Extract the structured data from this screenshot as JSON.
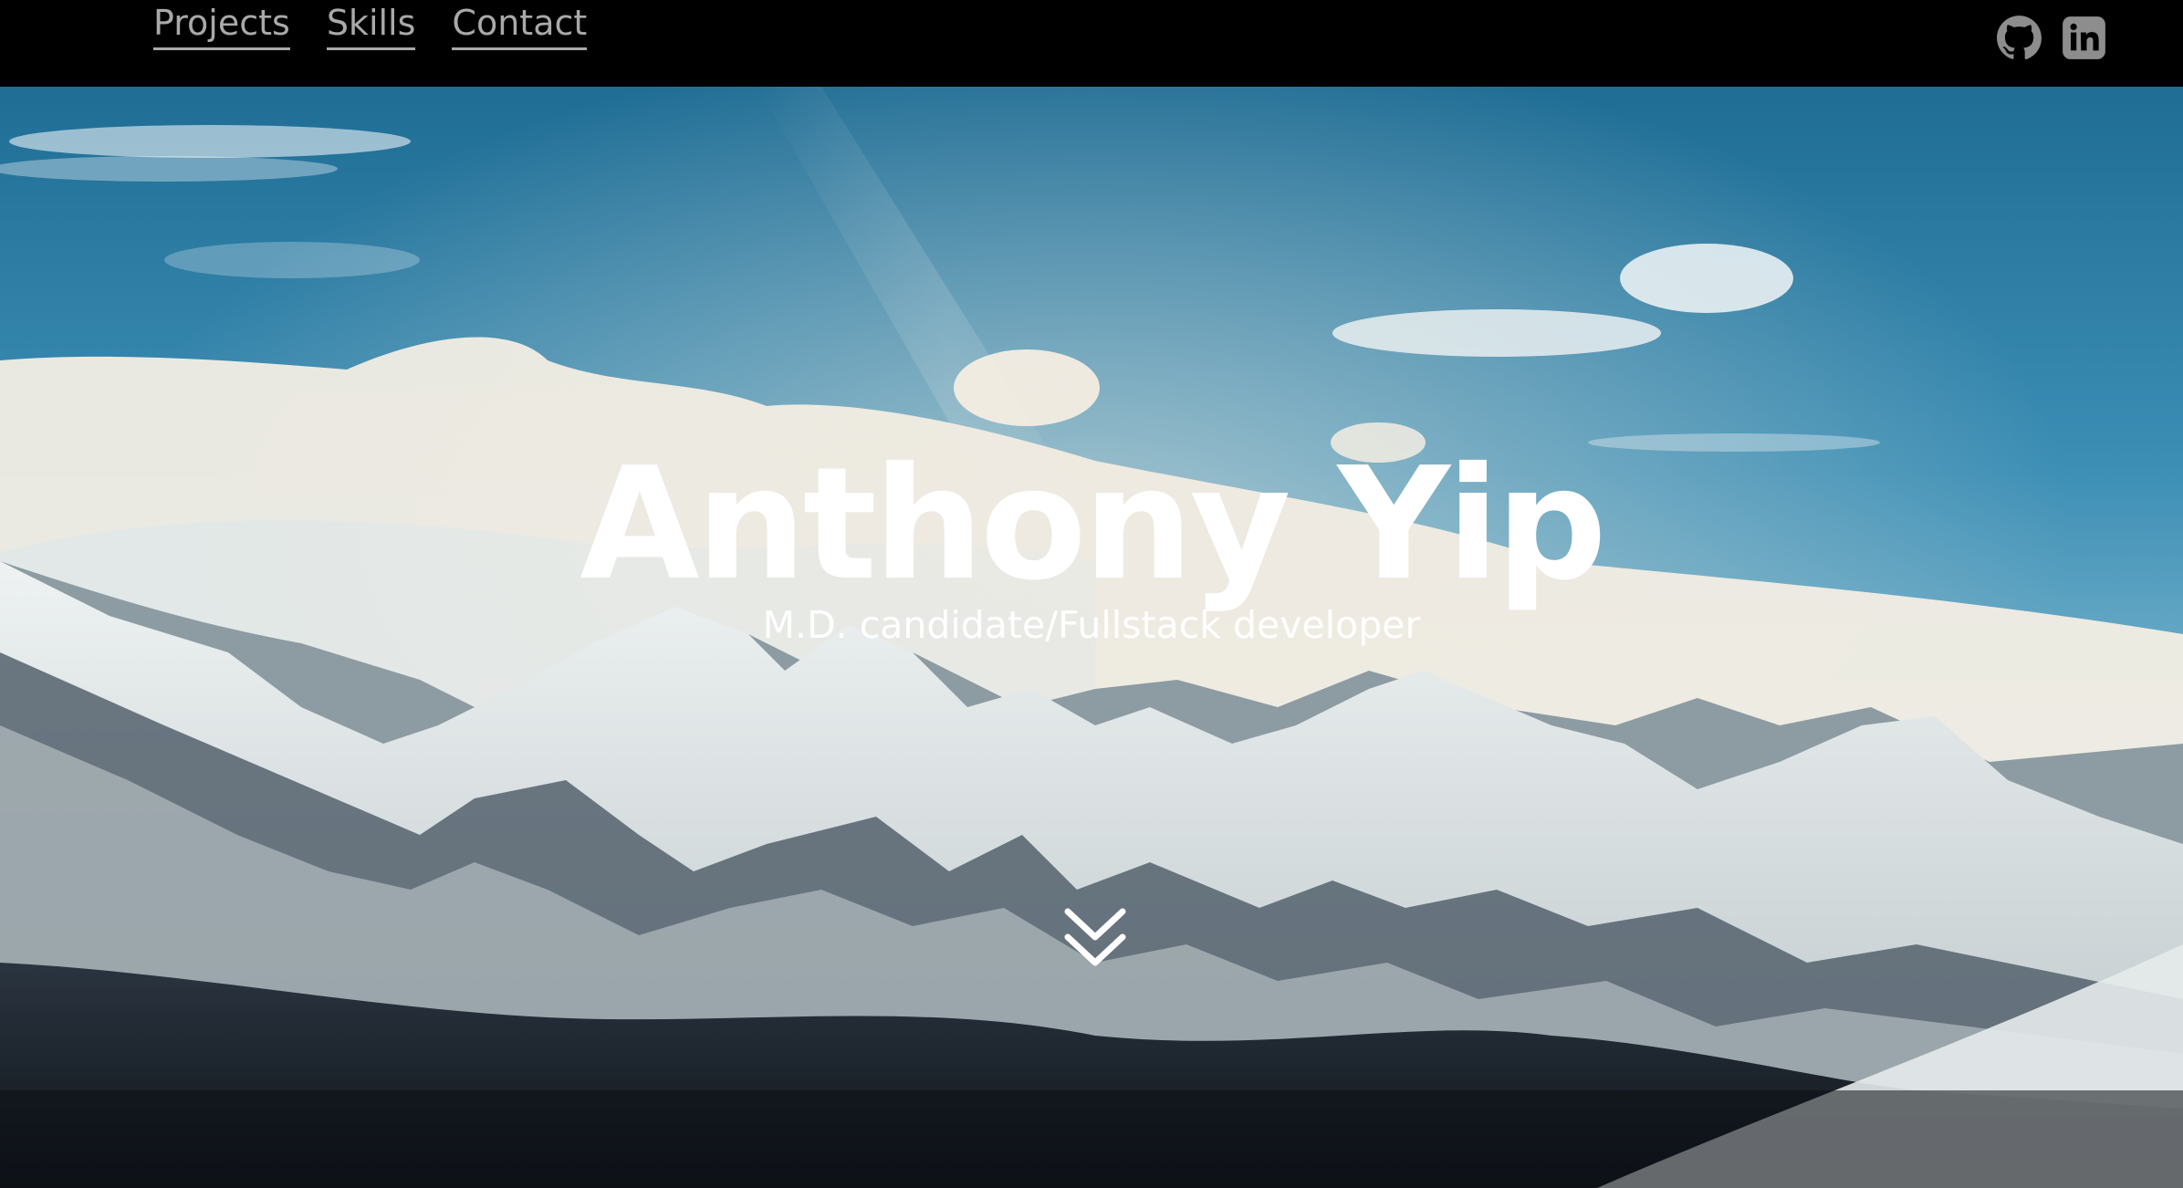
{
  "nav": {
    "items": [
      {
        "label": "Projects"
      },
      {
        "label": "Skills"
      },
      {
        "label": "Contact"
      }
    ]
  },
  "social": {
    "icons": [
      "github-icon",
      "linkedin-icon"
    ]
  },
  "hero": {
    "title": "Anthony Yip",
    "subtitle": "M.D. candidate/Fullstack developer",
    "scroll_icon": "double-chevron-down-icon",
    "background": "snowy mountain range under blue sky with clouds"
  },
  "colors": {
    "topbar": "#000000",
    "nav_text": "#a9a9a9",
    "hero_text": "#ffffff",
    "sky_top": "#2f7fa6",
    "sky_bottom": "#6aa9c6"
  }
}
